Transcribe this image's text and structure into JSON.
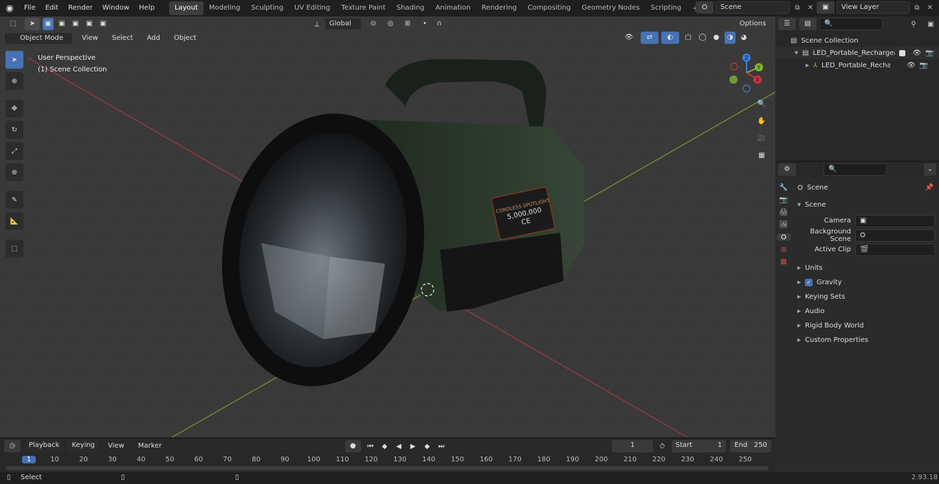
{
  "topbar": {
    "menus": [
      "File",
      "Edit",
      "Render",
      "Window",
      "Help"
    ],
    "workspaces": [
      "Layout",
      "Modeling",
      "Sculpting",
      "UV Editing",
      "Texture Paint",
      "Shading",
      "Animation",
      "Rendering",
      "Compositing",
      "Geometry Nodes",
      "Scripting"
    ],
    "active_workspace": "Layout",
    "add_tab": "+",
    "scene_name": "Scene",
    "view_layer": "View Layer"
  },
  "viewport": {
    "mode": "Object Mode",
    "menus": [
      "View",
      "Select",
      "Add",
      "Object"
    ],
    "transform_orientation": "Global",
    "options_label": "Options",
    "perspective_label": "User Perspective",
    "collection_label": "(1) Scene Collection",
    "gizmo": {
      "x": "X",
      "y": "Y",
      "z": "Z"
    },
    "label": {
      "line1": "CORDLESS SPOTLIGHT",
      "line2": "5,000,000",
      "line3": "CE"
    }
  },
  "outliner": {
    "root": "Scene Collection",
    "item1": "LED_Portable_Rechargeable_",
    "item2": "LED_Portable_Rechargea"
  },
  "properties": {
    "context": "Scene",
    "panel": "Scene",
    "camera_label": "Camera",
    "background_label": "Background Scene",
    "clip_label": "Active Clip",
    "sections": [
      "Units",
      "Gravity",
      "Keying Sets",
      "Audio",
      "Rigid Body World",
      "Custom Properties"
    ],
    "gravity_checked": true
  },
  "timeline": {
    "menus": [
      "Playback",
      "Keying",
      "View",
      "Marker"
    ],
    "current_frame": "1",
    "start_label": "Start",
    "start": "1",
    "end_label": "End",
    "end": "250",
    "ruler": [
      "1",
      "10",
      "20",
      "30",
      "40",
      "50",
      "60",
      "70",
      "80",
      "90",
      "100",
      "110",
      "120",
      "130",
      "140",
      "150",
      "160",
      "170",
      "180",
      "190",
      "200",
      "210",
      "220",
      "230",
      "240",
      "250"
    ]
  },
  "status": {
    "left": "Select",
    "version": "2.93.18"
  },
  "colors": {
    "accent": "#4772b3",
    "x_axis": "#c8353f",
    "y_axis": "#7eb52f",
    "z_axis": "#3a7fdc"
  }
}
